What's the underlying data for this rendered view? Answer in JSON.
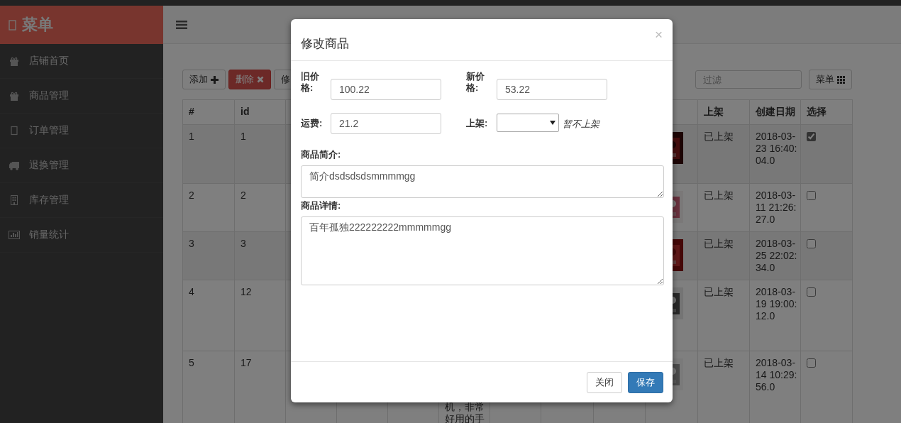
{
  "sidebar": {
    "title": "菜单",
    "items": [
      {
        "label": "店铺首页"
      },
      {
        "label": "商品管理"
      },
      {
        "label": "订单管理"
      },
      {
        "label": "退换管理"
      },
      {
        "label": "库存管理"
      },
      {
        "label": "销量统计"
      }
    ]
  },
  "toolbar": {
    "buttons": [
      {
        "label": "添加",
        "kind": "add"
      },
      {
        "label": "删除",
        "kind": "delete"
      },
      {
        "label": "修",
        "kind": "edit"
      }
    ],
    "filter": {
      "placeholder": "过滤"
    },
    "menu_button": "菜单"
  },
  "table": {
    "columns": [
      "#",
      "id",
      "上架",
      "创建日期",
      "选择"
    ],
    "rows": [
      {
        "num": "1",
        "id": "1",
        "shelf": "已上架",
        "created": "2018-03-23 16:40:04.0",
        "checked": true
      },
      {
        "num": "2",
        "id": "2",
        "shelf": "已上架",
        "created": "2018-03-11 21:26:27.0",
        "checked": false
      },
      {
        "num": "3",
        "id": "3",
        "shelf": "已上架",
        "created": "2018-03-25 22:02:34.0",
        "checked": false
      },
      {
        "num": "4",
        "id": "12",
        "shelf": "已上架",
        "created": "2018-03-19 19:00:12.0",
        "checked": false
      },
      {
        "num": "5",
        "id": "17",
        "description": "机，非常好用的手",
        "shelf": "已上架",
        "created": "2018-03-14 10:29:56.0",
        "checked": false
      }
    ]
  },
  "modal": {
    "title": "修改商品",
    "close": "×",
    "old_price": {
      "label": "旧价格:",
      "value": "100.22"
    },
    "new_price": {
      "label": "新价格:",
      "value": "53.22"
    },
    "shipping": {
      "label": "运费:",
      "value": "21.2"
    },
    "shelf": {
      "label": "上架:",
      "note": "暂不上架"
    },
    "intro": {
      "label": "商品简介:",
      "value": "简介dsdsdsdsmmmmgg"
    },
    "details": {
      "label": "商品详情:",
      "value": "百年孤独222222222mmmmmgg"
    },
    "buttons": [
      {
        "label": "关闭",
        "kind": "default"
      },
      {
        "label": "保存",
        "kind": "primary"
      }
    ]
  }
}
